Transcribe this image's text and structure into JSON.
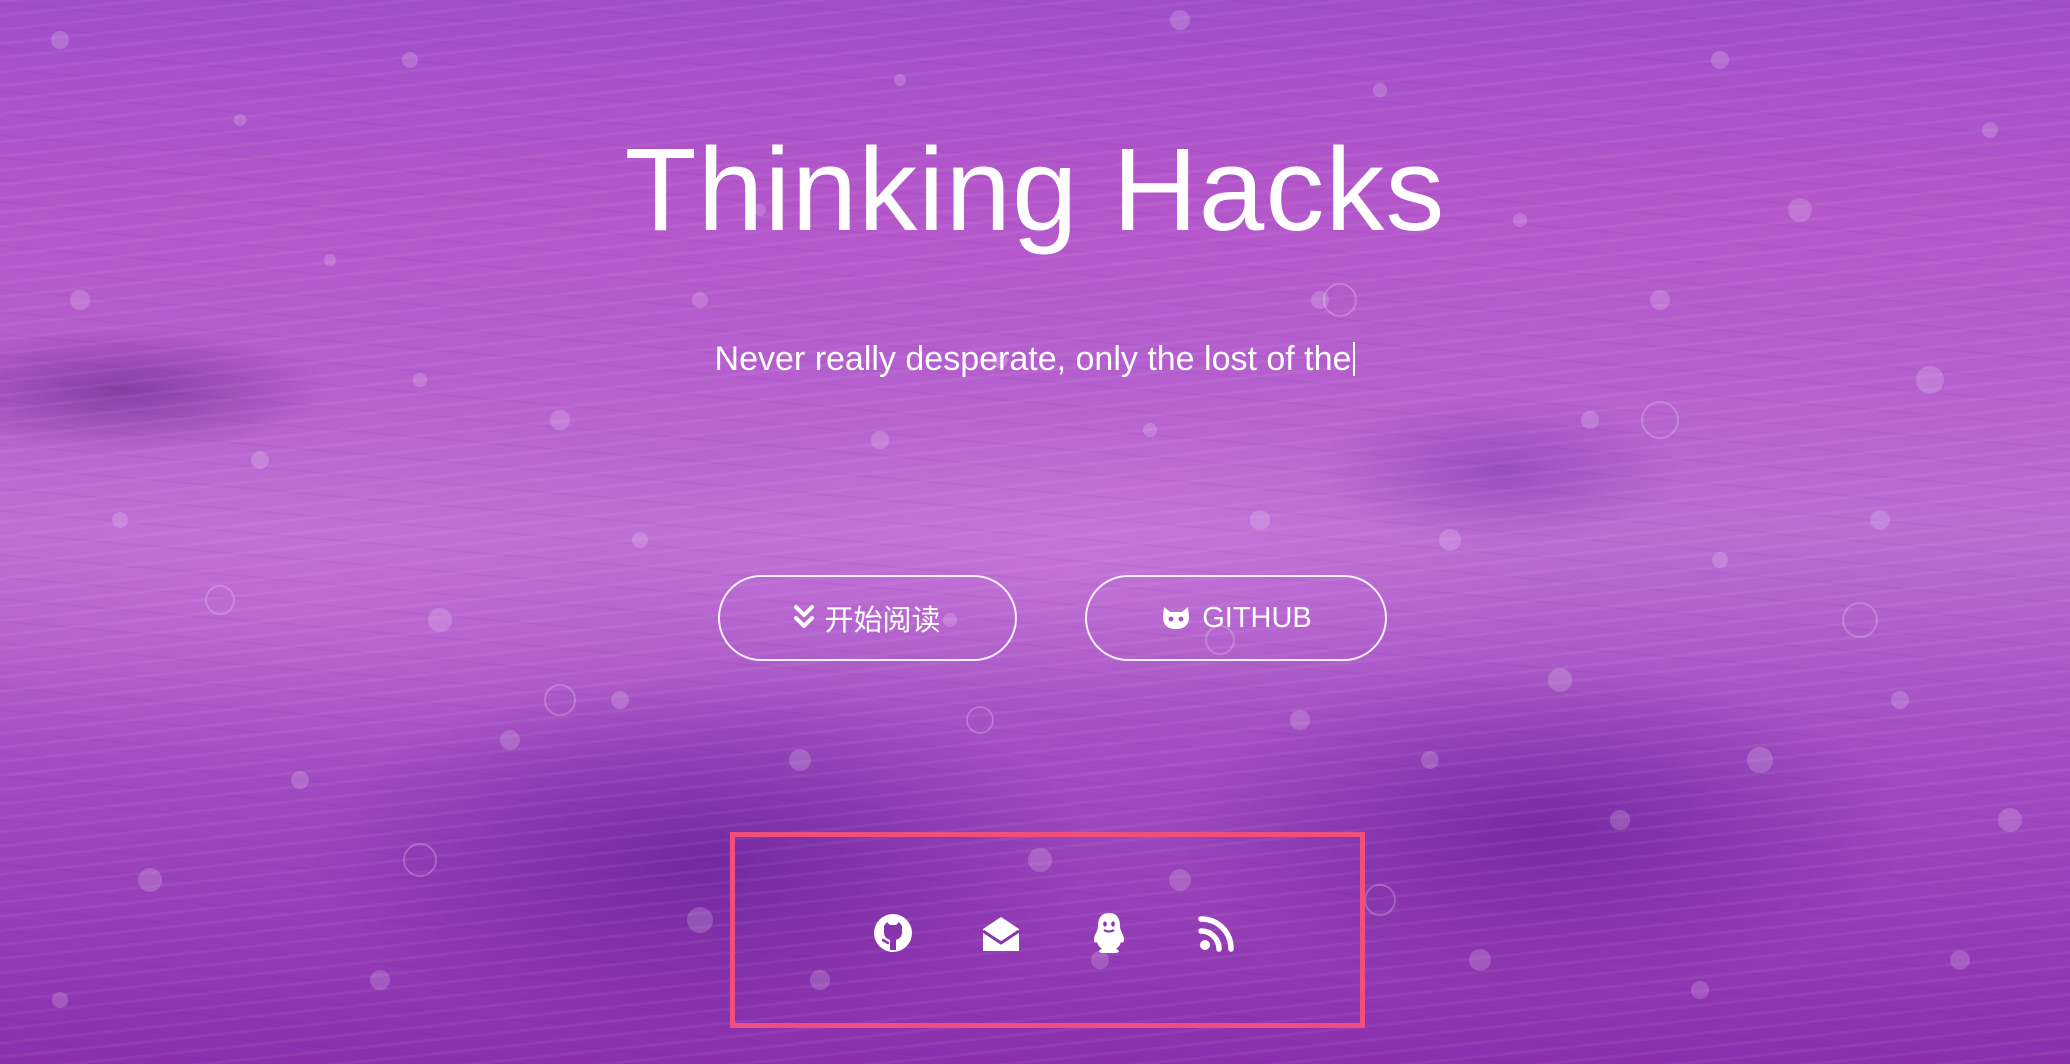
{
  "hero": {
    "title": "Thinking Hacks",
    "subtitle": "Never really desperate, only the lost of the",
    "accent_color": "#ef4f7c",
    "overlay_color": "#a44fc8"
  },
  "buttons": {
    "read": {
      "label": "开始阅读",
      "icon": "chevron-double-down-icon"
    },
    "github": {
      "label": "GITHUB",
      "icon": "github-octocat-icon"
    }
  },
  "social": {
    "icons": [
      "github-icon",
      "mail-icon",
      "qq-icon",
      "rss-icon"
    ]
  }
}
